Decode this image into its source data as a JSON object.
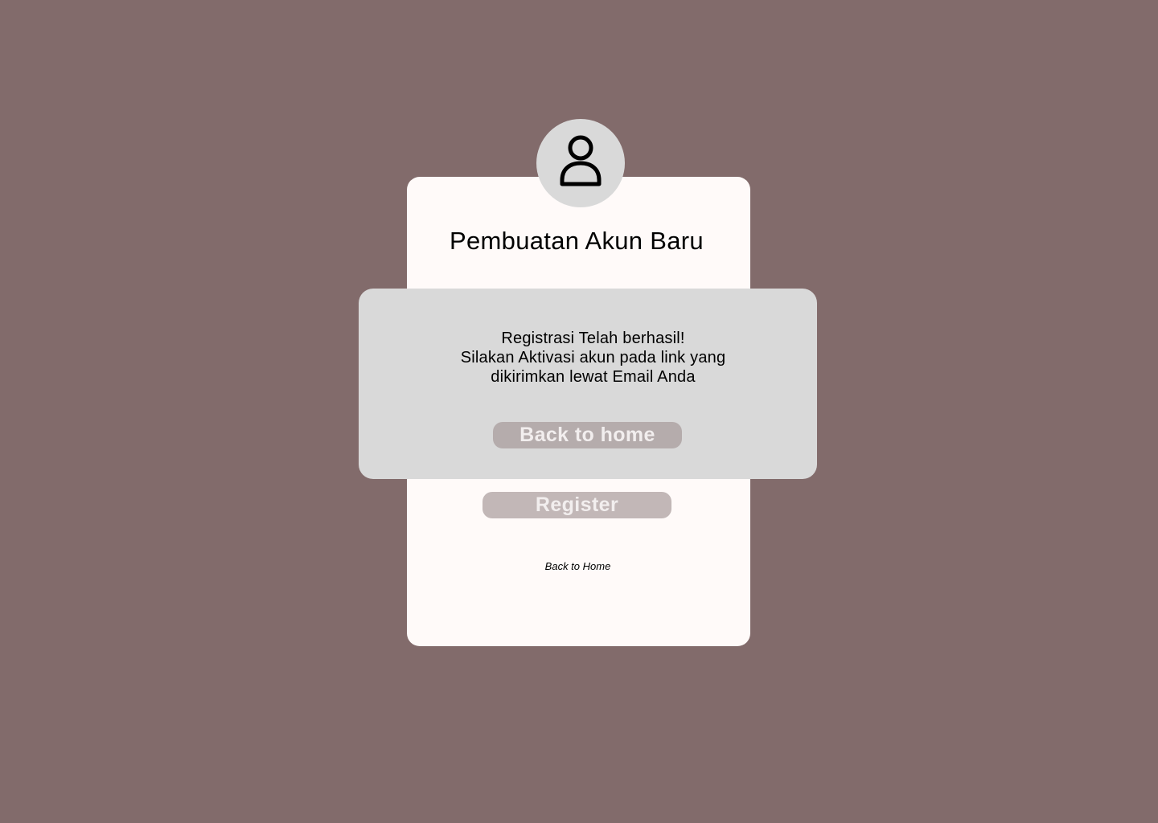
{
  "page": {
    "background_color": "#826b6b"
  },
  "card": {
    "avatar_icon": "user-icon",
    "title": "Pembuatan Akun Baru",
    "register_label": "Register",
    "back_link_label": "Back to Home"
  },
  "modal": {
    "message_lines": [
      "Registrasi Telah berhasil!",
      "Silakan Aktivasi akun pada link yang",
      "dikirimkan lewat Email Anda"
    ],
    "button_label": "Back to home"
  }
}
